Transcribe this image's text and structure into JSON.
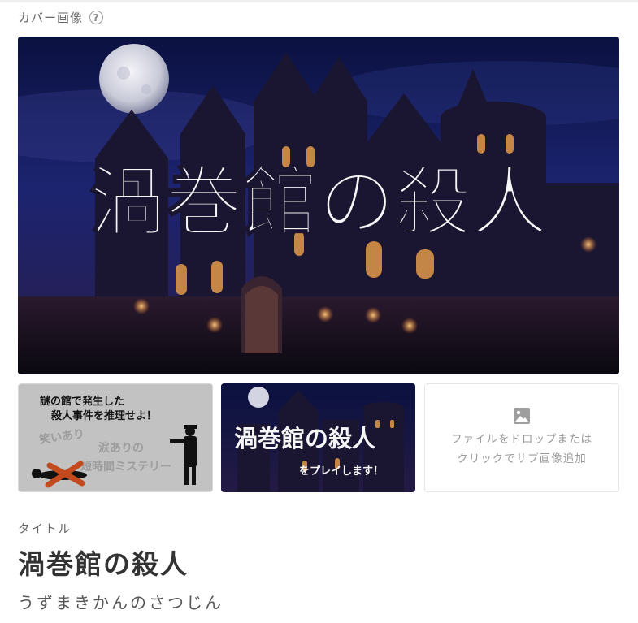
{
  "cover_section": {
    "label": "カバー画像",
    "help_icon": "question-circle-icon",
    "main_image": {
      "overlay_title": "渦巻館の殺人"
    }
  },
  "sub_images": [
    {
      "text_line1": "謎の館で発生した",
      "text_line2": "殺人事件を推理せよ！",
      "tag1": "笑いあり",
      "tag2": "涙ありの",
      "tag3": "短時間ミステリー"
    },
    {
      "overlay_title": "渦巻館の殺人",
      "overlay_subtitle": "をプレイします！"
    }
  ],
  "upload": {
    "icon": "image-icon",
    "line1": "ファイルをドロップまたは",
    "line2": "クリックでサブ画像追加"
  },
  "title_section": {
    "label": "タイトル",
    "value": "渦巻館の殺人",
    "reading": "うずまきかんのさつじん"
  },
  "colors": {
    "night_sky": "#1a1f5c",
    "window_glow": "#f0a040",
    "text_label": "#666666"
  }
}
